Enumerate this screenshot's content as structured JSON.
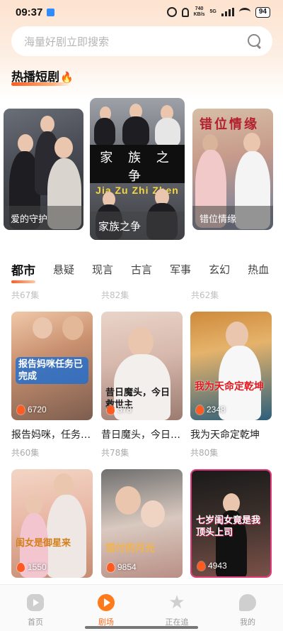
{
  "status_bar": {
    "time": "09:37",
    "net_speed_value": "740",
    "net_speed_unit": "KB/s",
    "network": "5G",
    "battery": "94"
  },
  "search": {
    "placeholder": "海量好剧立即搜索"
  },
  "hot_section": {
    "title": "热播短剧",
    "icon": "fire-icon",
    "items": [
      {
        "title": "爱的守护"
      },
      {
        "title": "家族之争",
        "poster_text_cn": "家 族 之 争",
        "poster_text_en": "Jia Zu Zhi Zhen"
      },
      {
        "title": "错位情缘"
      }
    ]
  },
  "tabs": [
    "都市",
    "悬疑",
    "现言",
    "古言",
    "军事",
    "玄幻",
    "热血"
  ],
  "active_tab": "都市",
  "peek_row": [
    "共67集",
    "共82集",
    "共62集"
  ],
  "grid": [
    {
      "title": "报告妈咪，任务已完成",
      "views": "6720",
      "episodes": "共60集",
      "poster_text": "报告妈咪任务已完成"
    },
    {
      "title": "昔日魔头，今日救世主",
      "views": "378",
      "episodes": "共78集",
      "poster_text": "昔日魔头，今日救世主"
    },
    {
      "title": "我为天命定乾坤",
      "views": "2348",
      "episodes": "共80集",
      "poster_text": "我为天命定乾坤"
    },
    {
      "title": "",
      "views": "1550",
      "episodes": "",
      "poster_text": "闺女是御星来"
    },
    {
      "title": "",
      "views": "9854",
      "episodes": "",
      "poster_text": "错付的月光"
    },
    {
      "title": "",
      "views": "4943",
      "episodes": "",
      "poster_text": "七岁闺女竟是我顶头上司"
    }
  ],
  "bottom_nav": [
    {
      "label": "首页",
      "icon": "home-icon",
      "active": false
    },
    {
      "label": "剧场",
      "icon": "theater-icon",
      "active": true
    },
    {
      "label": "正在追",
      "icon": "star-icon",
      "active": false
    },
    {
      "label": "我的",
      "icon": "profile-icon",
      "active": false
    }
  ],
  "colors": {
    "accent": "#ff6a1a",
    "top_gradient": "#fde3cf"
  }
}
